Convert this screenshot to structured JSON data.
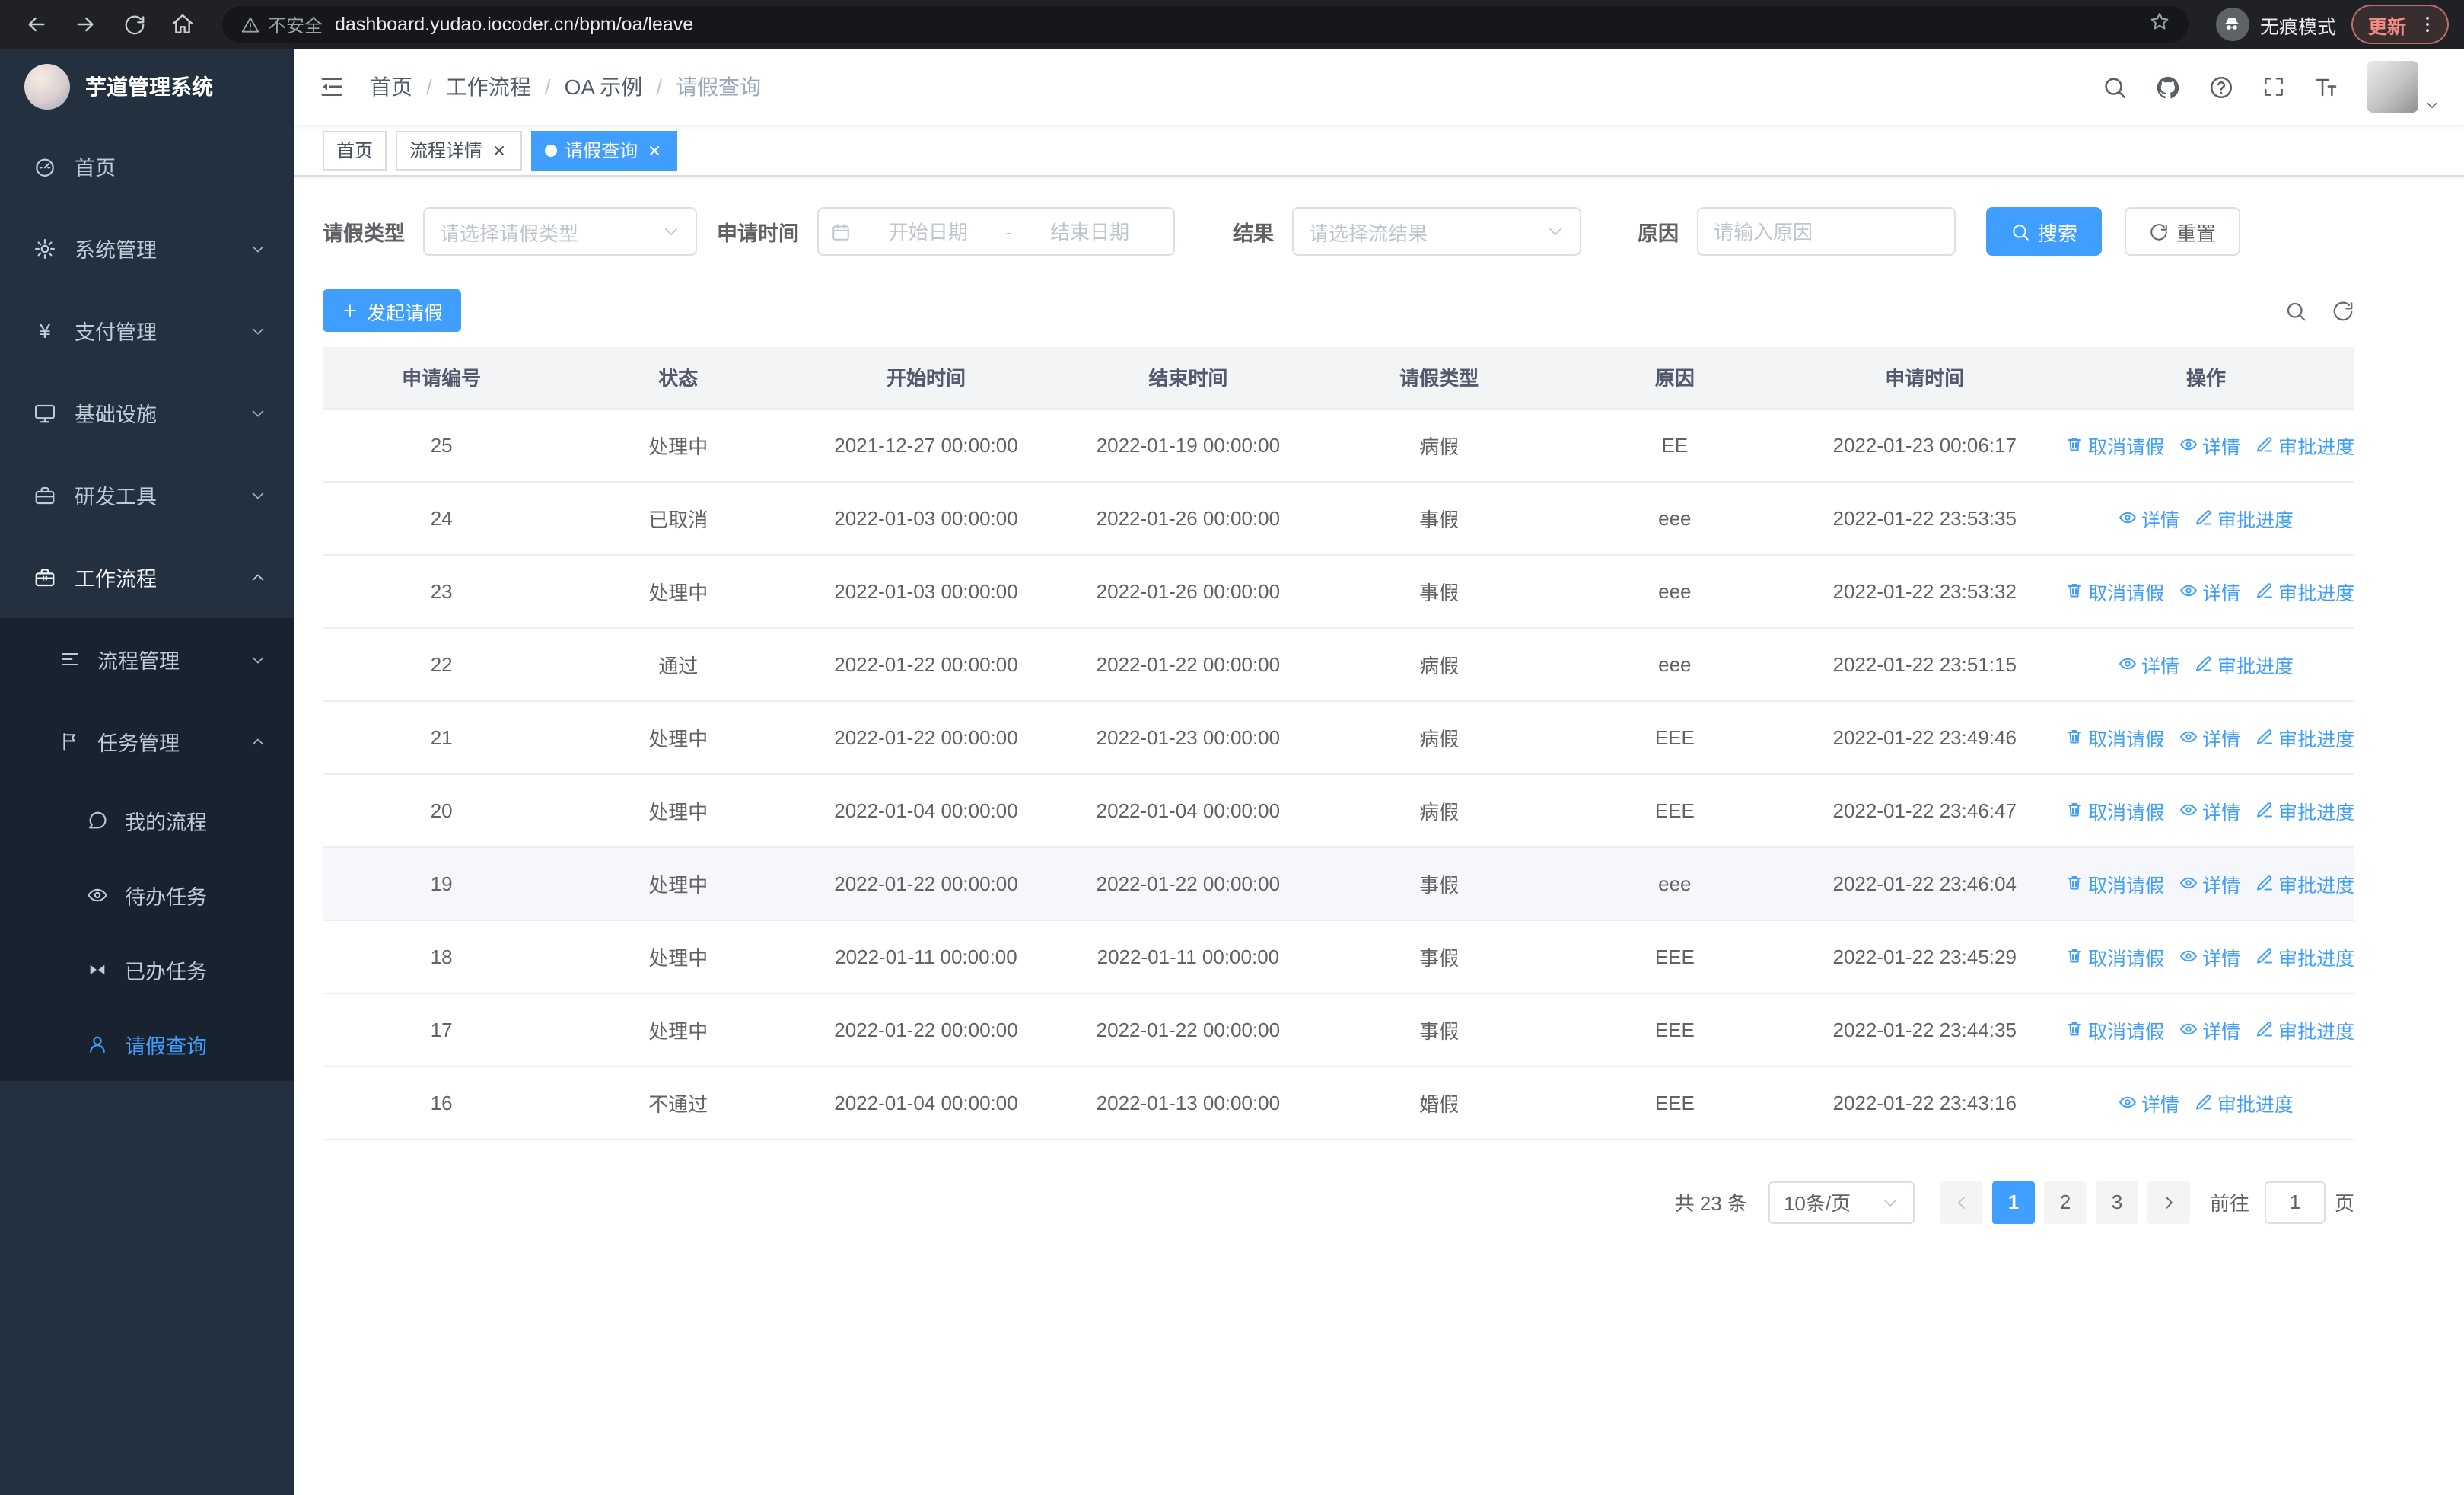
{
  "browser": {
    "url": "dashboard.yudao.iocoder.cn/bpm/oa/leave",
    "security_text": "不安全",
    "incognito_label": "无痕模式",
    "update_label": "更新"
  },
  "sidebar": {
    "logo_title": "芋道管理系统",
    "items": [
      {
        "label": "首页",
        "icon": "dashboard-icon"
      },
      {
        "label": "系统管理",
        "icon": "gear-icon"
      },
      {
        "label": "支付管理",
        "icon": "yen-icon"
      },
      {
        "label": "基础设施",
        "icon": "monitor-icon"
      },
      {
        "label": "研发工具",
        "icon": "toolbox-icon"
      },
      {
        "label": "工作流程",
        "icon": "briefcase-icon"
      }
    ],
    "workflow_children": [
      {
        "label": "流程管理",
        "icon": "tree-list-icon"
      },
      {
        "label": "任务管理",
        "icon": "flag-icon"
      }
    ],
    "task_children": [
      {
        "label": "我的流程",
        "icon": "chat-icon"
      },
      {
        "label": "待办任务",
        "icon": "eye-icon"
      },
      {
        "label": "已办任务",
        "icon": "bowtie-icon"
      },
      {
        "label": "请假查询",
        "icon": "person-icon"
      }
    ]
  },
  "navbar": {
    "breadcrumb": {
      "items": [
        "首页",
        "工作流程",
        "OA 示例",
        "请假查询"
      ],
      "separator": "/"
    },
    "icons": [
      "search-icon",
      "github-icon",
      "help-icon",
      "fullscreen-icon",
      "font-size-icon"
    ]
  },
  "tags": [
    {
      "label": "首页"
    },
    {
      "label": "流程详情"
    },
    {
      "label": "请假查询"
    }
  ],
  "filters": {
    "leave_type": {
      "label": "请假类型",
      "placeholder": "请选择请假类型"
    },
    "apply_time": {
      "label": "申请时间",
      "start_placeholder": "开始日期",
      "separator": "-",
      "end_placeholder": "结束日期"
    },
    "result": {
      "label": "结果",
      "placeholder": "请选择流结果"
    },
    "reason": {
      "label": "原因",
      "placeholder": "请输入原因"
    },
    "search_label": "搜索",
    "reset_label": "重置"
  },
  "toolbar": {
    "create_label": "发起请假"
  },
  "table": {
    "columns": [
      "申请编号",
      "状态",
      "开始时间",
      "结束时间",
      "请假类型",
      "原因",
      "申请时间",
      "操作"
    ],
    "action_defs": {
      "cancel": {
        "label": "取消请假",
        "icon": "trash-icon"
      },
      "detail": {
        "label": "详情",
        "icon": "eye-icon"
      },
      "progress": {
        "label": "审批进度",
        "icon": "edit-icon"
      }
    },
    "rows": [
      {
        "id": "25",
        "status": "处理中",
        "start": "2021-12-27 00:00:00",
        "end": "2022-01-19 00:00:00",
        "type": "病假",
        "reason": "EE",
        "applied": "2022-01-23 00:06:17",
        "actions": [
          "cancel",
          "detail",
          "progress"
        ]
      },
      {
        "id": "24",
        "status": "已取消",
        "start": "2022-01-03 00:00:00",
        "end": "2022-01-26 00:00:00",
        "type": "事假",
        "reason": "eee",
        "applied": "2022-01-22 23:53:35",
        "actions": [
          "detail",
          "progress"
        ]
      },
      {
        "id": "23",
        "status": "处理中",
        "start": "2022-01-03 00:00:00",
        "end": "2022-01-26 00:00:00",
        "type": "事假",
        "reason": "eee",
        "applied": "2022-01-22 23:53:32",
        "actions": [
          "cancel",
          "detail",
          "progress"
        ]
      },
      {
        "id": "22",
        "status": "通过",
        "start": "2022-01-22 00:00:00",
        "end": "2022-01-22 00:00:00",
        "type": "病假",
        "reason": "eee",
        "applied": "2022-01-22 23:51:15",
        "actions": [
          "detail",
          "progress"
        ]
      },
      {
        "id": "21",
        "status": "处理中",
        "start": "2022-01-22 00:00:00",
        "end": "2022-01-23 00:00:00",
        "type": "病假",
        "reason": "EEE",
        "applied": "2022-01-22 23:49:46",
        "actions": [
          "cancel",
          "detail",
          "progress"
        ]
      },
      {
        "id": "20",
        "status": "处理中",
        "start": "2022-01-04 00:00:00",
        "end": "2022-01-04 00:00:00",
        "type": "病假",
        "reason": "EEE",
        "applied": "2022-01-22 23:46:47",
        "actions": [
          "cancel",
          "detail",
          "progress"
        ]
      },
      {
        "id": "19",
        "status": "处理中",
        "start": "2022-01-22 00:00:00",
        "end": "2022-01-22 00:00:00",
        "type": "事假",
        "reason": "eee",
        "applied": "2022-01-22 23:46:04",
        "actions": [
          "cancel",
          "detail",
          "progress"
        ],
        "highlighted": true
      },
      {
        "id": "18",
        "status": "处理中",
        "start": "2022-01-11 00:00:00",
        "end": "2022-01-11 00:00:00",
        "type": "事假",
        "reason": "EEE",
        "applied": "2022-01-22 23:45:29",
        "actions": [
          "cancel",
          "detail",
          "progress"
        ]
      },
      {
        "id": "17",
        "status": "处理中",
        "start": "2022-01-22 00:00:00",
        "end": "2022-01-22 00:00:00",
        "type": "事假",
        "reason": "EEE",
        "applied": "2022-01-22 23:44:35",
        "actions": [
          "cancel",
          "detail",
          "progress"
        ]
      },
      {
        "id": "16",
        "status": "不通过",
        "start": "2022-01-04 00:00:00",
        "end": "2022-01-13 00:00:00",
        "type": "婚假",
        "reason": "EEE",
        "applied": "2022-01-22 23:43:16",
        "actions": [
          "detail",
          "progress"
        ]
      }
    ]
  },
  "pagination": {
    "total_label": "共 23 条",
    "page_size_label": "10条/页",
    "pages": [
      1,
      2,
      3
    ],
    "active_page": 1,
    "goto_prefix": "前往",
    "goto_value": "1",
    "goto_suffix": "页"
  },
  "colors": {
    "primary": "#409eff",
    "sidebar_bg": "#22303f",
    "submenu_bg": "#18232f"
  }
}
